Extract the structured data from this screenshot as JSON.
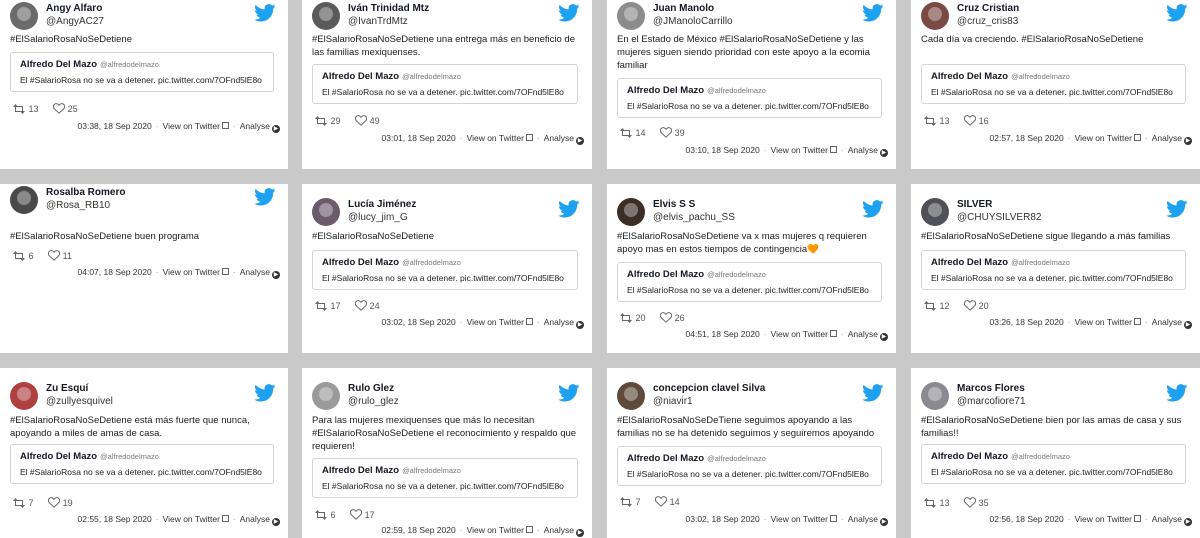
{
  "brand_color": "#1da1f2",
  "quote": {
    "author": "Alfredo Del Mazo",
    "handle": "@alfredodelmazo",
    "text": "El #SalarioRosa no se va a detener. pic.twitter.com/7OFnd5lE8o"
  },
  "labels": {
    "view_on_twitter": "View on Twitter",
    "analyse": "Analyse"
  },
  "icons": {
    "logo": "twitter-bird-icon",
    "retweet": "retweet-icon",
    "like": "heart-icon",
    "external": "external-link-icon",
    "analyse": "arrow-circle-icon"
  },
  "tweets": [
    {
      "name": "Angy Alfaro",
      "handle": "@AngyAC27",
      "text": "#ElSalarioRosaNoSeDetiene",
      "retweets": "13",
      "likes": "25",
      "time": "03:38, 18 Sep 2020",
      "avatar_color": "#6b6b6b"
    },
    {
      "name": "Iván Trinidad Mtz",
      "handle": "@IvanTrdMtz",
      "text": "#ElSalarioRosaNoSeDetiene una entrega más en beneficio de las familias mexiquenses.",
      "retweets": "29",
      "likes": "49",
      "time": "03:01, 18 Sep 2020",
      "avatar_color": "#5a5a5a"
    },
    {
      "name": "Juan Manolo",
      "handle": "@JManoloCarrillo",
      "text": "En el Estado de México #ElSalarioRosaNoSeDetiene y las mujeres siguen siendo prioridad con este apoyo a la ecomia familiar",
      "retweets": "14",
      "likes": "39",
      "time": "03:10, 18 Sep 2020",
      "avatar_color": "#8c8c8c"
    },
    {
      "name": "Cruz Cristian",
      "handle": "@cruz_cris83",
      "text": "Cada día va creciendo. #ElSalarioRosaNoSeDetiene",
      "retweets": "13",
      "likes": "16",
      "time": "02:57, 18 Sep 2020",
      "avatar_color": "#7a4a44"
    },
    {
      "name": "Rosalba Romero",
      "handle": "@Rosa_RB10",
      "text": "#ElSalarioRosaNoSeDetiene buen programa",
      "retweets": "6",
      "likes": "11",
      "time": "04:07, 18 Sep 2020",
      "avatar_color": "#4a4a4a"
    },
    {
      "name": "Lucía Jiménez",
      "handle": "@lucy_jim_G",
      "text": "#ElSalarioRosaNoSeDetiene",
      "retweets": "17",
      "likes": "24",
      "time": "03:02, 18 Sep 2020",
      "avatar_color": "#6a5a6a"
    },
    {
      "name": "Elvis S S",
      "handle": "@elvis_pachu_SS",
      "text": "#ElSalarioRosaNoSeDetiene va x mas mujeres q requieren apoyo mas en estos tiempos de contingencia🧡",
      "retweets": "20",
      "likes": "26",
      "time": "04:51, 18 Sep 2020",
      "avatar_color": "#3a2e26"
    },
    {
      "name": "SILVER",
      "handle": "@CHUYSILVER82",
      "text": "#ElSalarioRosaNoSeDetiene sigue llegando a más familias",
      "retweets": "12",
      "likes": "20",
      "time": "03:26, 18 Sep 2020",
      "avatar_color": "#505058"
    },
    {
      "name": "Zu Esquí",
      "handle": "@zullyesquivel",
      "text": "#ElSalarioRosaNoSeDetiene está más fuerte que nunca, apoyando a miles de amas de casa.",
      "retweets": "7",
      "likes": "19",
      "time": "02:55, 18 Sep 2020",
      "avatar_color": "#b04040"
    },
    {
      "name": "Rulo Glez",
      "handle": "@rulo_glez",
      "text": "Para las mujeres mexiquenses que más lo necesitan #ElSalarioRosaNoSeDetiene el reconocimiento y respaldo que requieren!",
      "retweets": "6",
      "likes": "17",
      "time": "02:59, 18 Sep 2020",
      "avatar_color": "#9a9a9a"
    },
    {
      "name": "concepcion clavel Silva",
      "handle": "@niavir1",
      "text": "#ElSalarioRosaNoSeDeTiene seguimos apoyando a las familias no se ha detenido seguimos y seguiremos apoyando",
      "retweets": "7",
      "likes": "14",
      "time": "03:02, 18 Sep 2020",
      "avatar_color": "#5e4a3a"
    },
    {
      "name": "Marcos Flores",
      "handle": "@marcofiore71",
      "text": "#ElSalarioRosaNoSeDetiene bien por las amas de casa y sus familias!!",
      "retweets": "13",
      "likes": "35",
      "time": "02:56, 18 Sep 2020",
      "avatar_color": "#8a8a92"
    }
  ]
}
